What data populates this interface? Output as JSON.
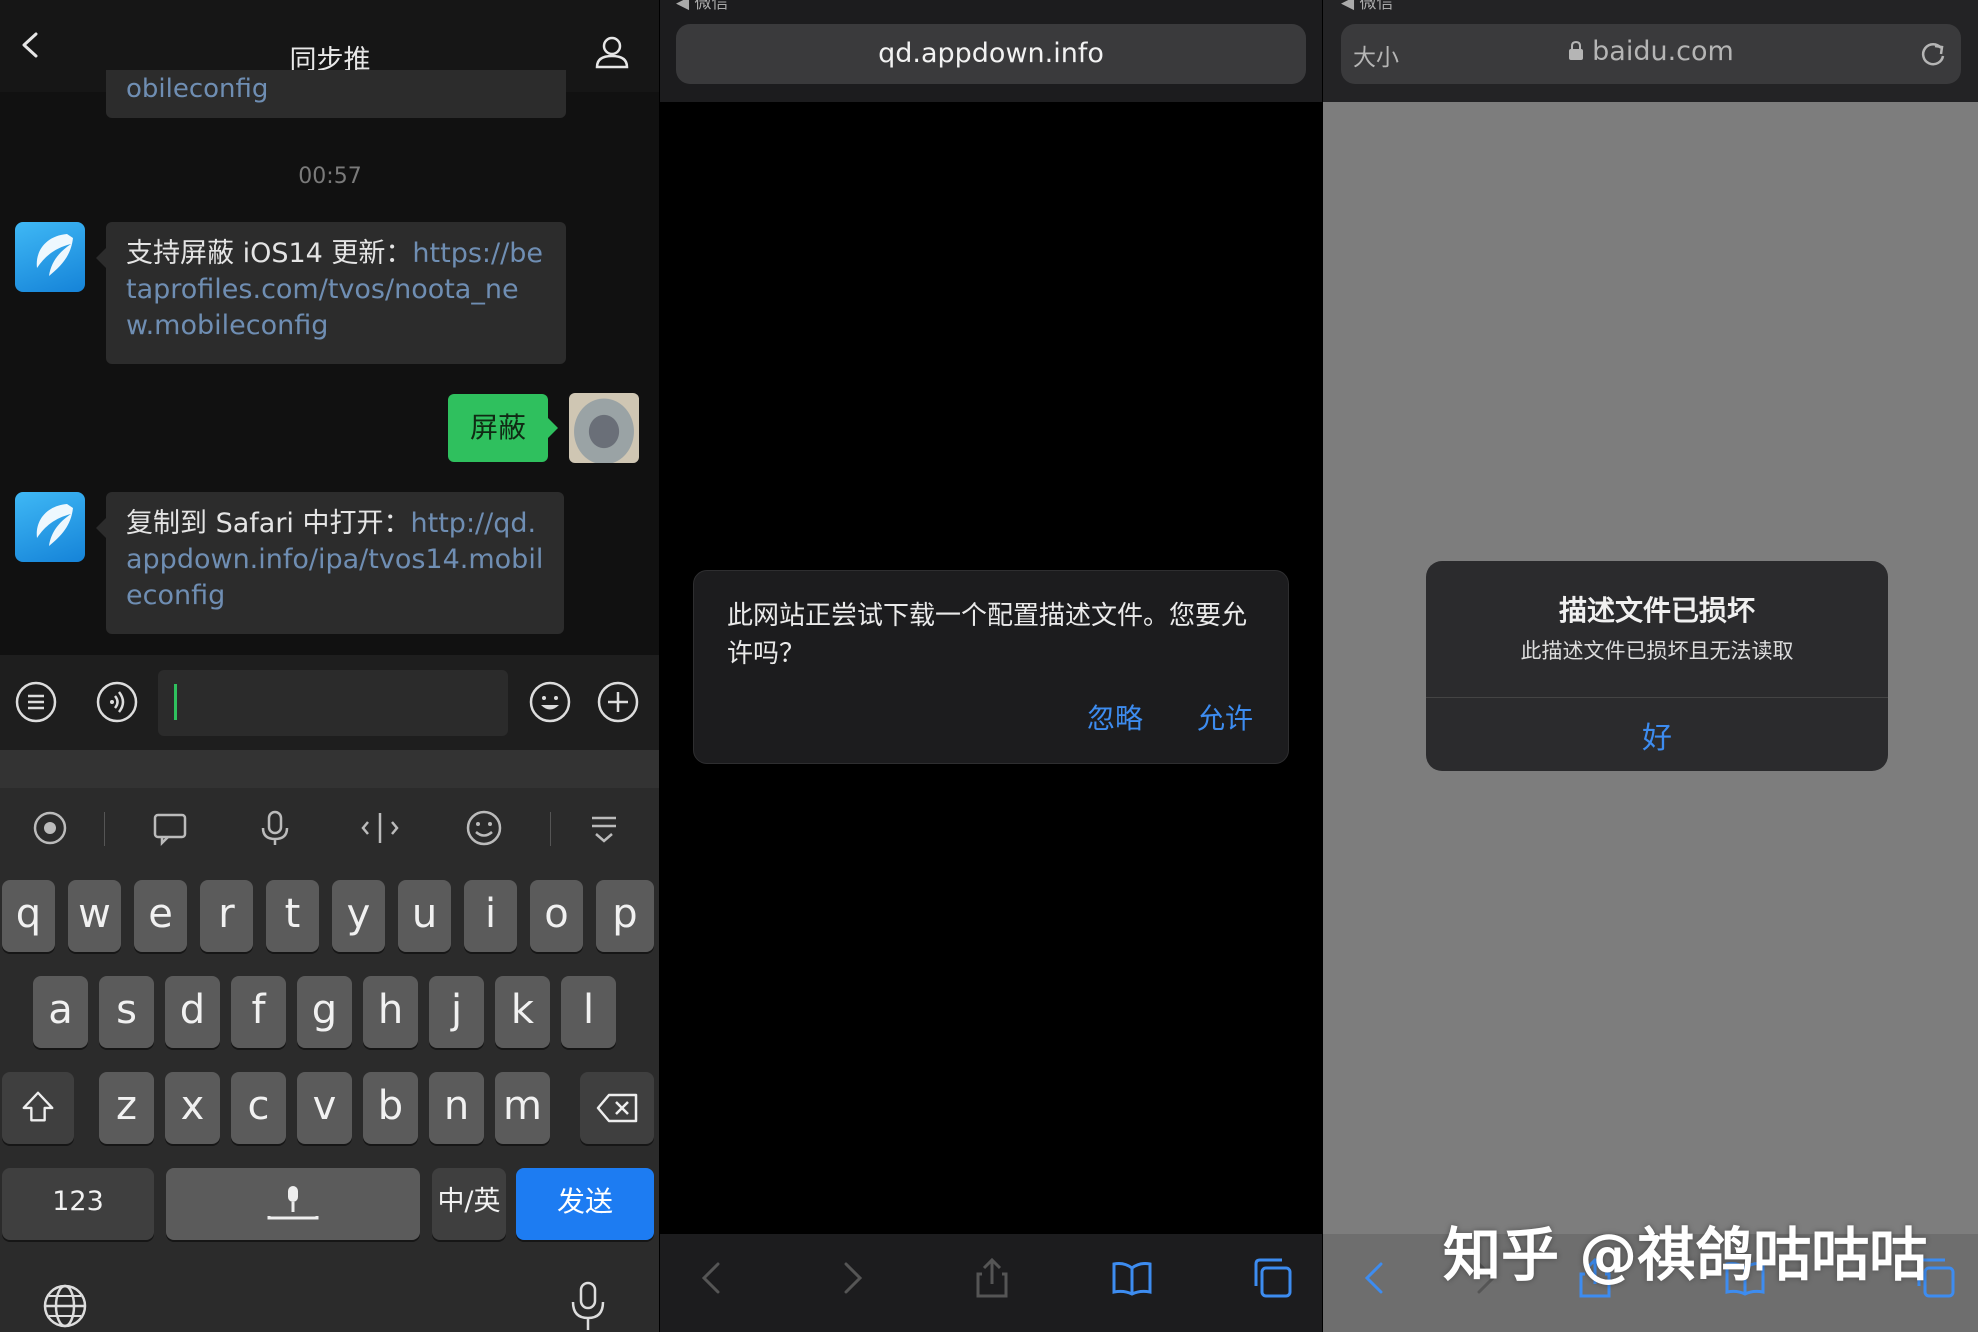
{
  "chat": {
    "title": "同步推",
    "prev_bubble_tail": "obileconfig",
    "time": "00:57",
    "messages": [
      {
        "text": "支持屏蔽 iOS14 更新：",
        "link": "https://betaprofiles.com/tvos/noota_new.mobileconfig"
      },
      {
        "text": "屏蔽"
      },
      {
        "text": "复制到 Safari 中打开：",
        "link": "http://qd.appdown.info/ipa/tvos14.mobileconfig"
      }
    ],
    "accent_color": "#2fc05e"
  },
  "keyboard": {
    "row1": [
      "q",
      "w",
      "e",
      "r",
      "t",
      "y",
      "u",
      "i",
      "o",
      "p"
    ],
    "row2": [
      "a",
      "s",
      "d",
      "f",
      "g",
      "h",
      "j",
      "k",
      "l"
    ],
    "row3": [
      "z",
      "x",
      "c",
      "v",
      "b",
      "n",
      "m"
    ],
    "numbers_key": "123",
    "lang_key": "中/英",
    "send_key": "发送"
  },
  "safari": {
    "status_label": "◀ 微信",
    "url": "qd.appdown.info",
    "alert_message": "此网站正尝试下载一个配置描述文件。您要允许吗？",
    "ignore": "忽略",
    "allow": "允许"
  },
  "profile_error": {
    "status_label": "◀ 微信",
    "text_size": "大小",
    "domain": "baidu.com",
    "title": "描述文件已损坏",
    "message": "此描述文件已损坏且无法读取",
    "ok": "好"
  },
  "watermark": "知乎 @祺鸽咕咕咕"
}
